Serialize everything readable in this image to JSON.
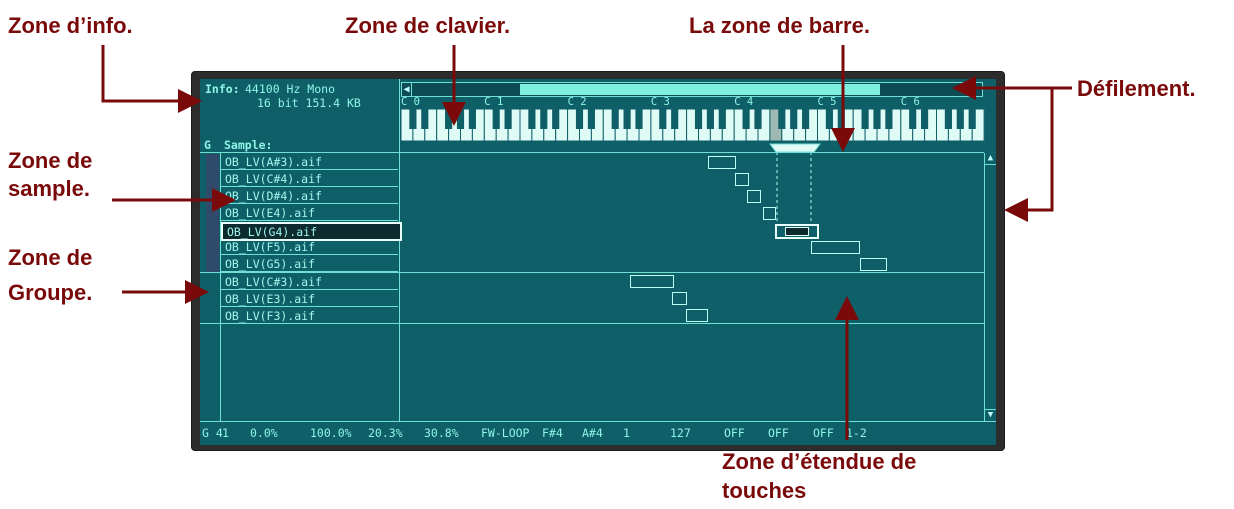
{
  "callouts": {
    "info_zone": "Zone d’info.",
    "keyboard_zone": "Zone de clavier.",
    "bar_zone": "La zone de barre.",
    "scroll": "Défilement.",
    "sample_zone_1": "Zone de",
    "sample_zone_2": "sample.",
    "group_zone_1": "Zone de",
    "group_zone_2": "Groupe.",
    "keyrange_zone_1": "Zone d’étendue de",
    "keyrange_zone_2": "touches"
  },
  "info": {
    "label": "Info:",
    "line1": "44100 Hz Mono",
    "line2": "16 bit 151.4 KB"
  },
  "sample_header": {
    "group_col": "G",
    "sample_col": "Sample:"
  },
  "octave_labels": [
    "C 0",
    "C 1",
    "C 2",
    "C 3",
    "C 4",
    "C 5",
    "C 6"
  ],
  "group1_samples": [
    "OB_LV(A#3).aif",
    "OB_LV(C#4).aif",
    "OB_LV(D#4).aif",
    "OB_LV(E4).aif",
    "OB_LV(G4).aif",
    "OB_LV(F5).aif",
    "OB_LV(G5).aif"
  ],
  "group2_samples": [
    "OB_LV(C#3).aif",
    "OB_LV(E3).aif",
    "OB_LV(F3).aif"
  ],
  "selected_sample_index": 4,
  "status_bar": [
    "G 4",
    "1",
    "0.0%",
    "100.0%",
    "20.3%",
    "30.8%",
    "FW-LOOP",
    "F#4",
    "A#4",
    "1",
    "127",
    "OFF",
    "OFF",
    "OFF",
    "1-2"
  ],
  "colors": {
    "callout": "#7a0a0a",
    "screen_bg": "#0f5f69",
    "accent": "#6fe0d4",
    "scroll_thumb": "#7ef0e0"
  }
}
